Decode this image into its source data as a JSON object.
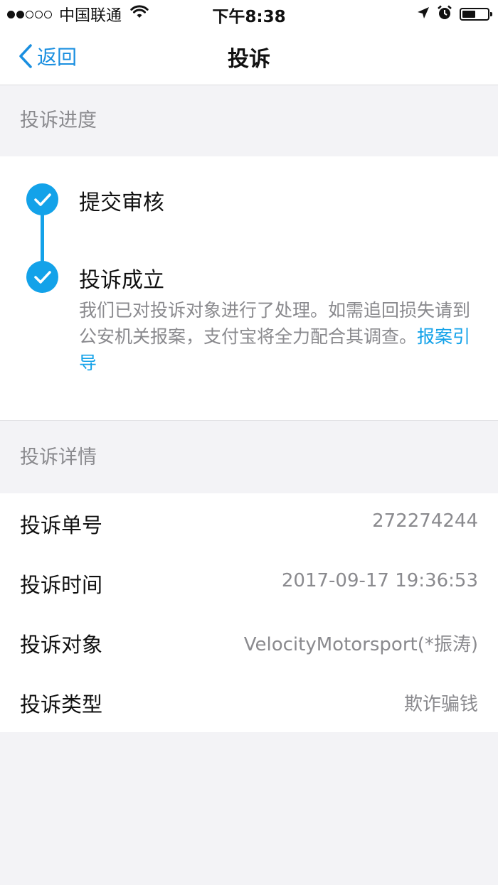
{
  "status_bar": {
    "carrier": "中国联通",
    "time": "下午8:38"
  },
  "nav": {
    "back_label": "返回",
    "title": "投诉"
  },
  "progress": {
    "header": "投诉进度",
    "steps": [
      {
        "title": "提交审核"
      },
      {
        "title": "投诉成立",
        "desc": "我们已对投诉对象进行了处理。如需追回损失请到公安机关报案，支付宝将全力配合其调查。",
        "link": "报案引导"
      }
    ]
  },
  "details": {
    "header": "投诉详情",
    "rows": [
      {
        "label": "投诉单号",
        "value": "272274244"
      },
      {
        "label": "投诉时间",
        "value": "2017-09-17 19:36:53"
      },
      {
        "label": "投诉对象",
        "value": "VelocityMotorsport(*振涛)"
      },
      {
        "label": "投诉类型",
        "value": "欺诈骗钱"
      }
    ]
  },
  "colors": {
    "accent": "#13a2e9",
    "link": "#1a8fe0",
    "secondary_text": "#8a8a8e",
    "background": "#f3f3f6"
  }
}
